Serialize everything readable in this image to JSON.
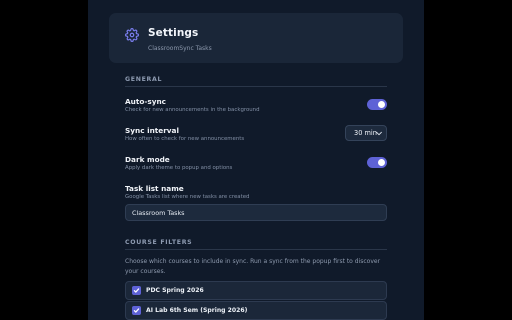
{
  "header": {
    "title": "Settings",
    "subtitle": "ClassroomSync Tasks",
    "icon": "gear-icon"
  },
  "general": {
    "section_title": "GENERAL",
    "auto_sync": {
      "label": "Auto-sync",
      "description": "Check for new announcements in the background",
      "enabled": true
    },
    "sync_interval": {
      "label": "Sync interval",
      "description": "How often to check for new announcements",
      "value": "30 min"
    },
    "dark_mode": {
      "label": "Dark mode",
      "description": "Apply dark theme to popup and options",
      "enabled": true
    },
    "task_list": {
      "label": "Task list name",
      "description": "Google Tasks list where new tasks are created",
      "value": "Classroom Tasks"
    }
  },
  "course_filters": {
    "section_title": "COURSE FILTERS",
    "help": "Choose which courses to include in sync. Run a sync from the popup first to discover your courses.",
    "courses": [
      {
        "label": "PDC Spring 2026",
        "checked": true
      },
      {
        "label": "AI Lab 6th Sem (Spring 2026)",
        "checked": true
      }
    ]
  },
  "colors": {
    "accent": "#5e62d6",
    "panel_bg": "#101a2a",
    "card_bg": "#1a2638"
  }
}
